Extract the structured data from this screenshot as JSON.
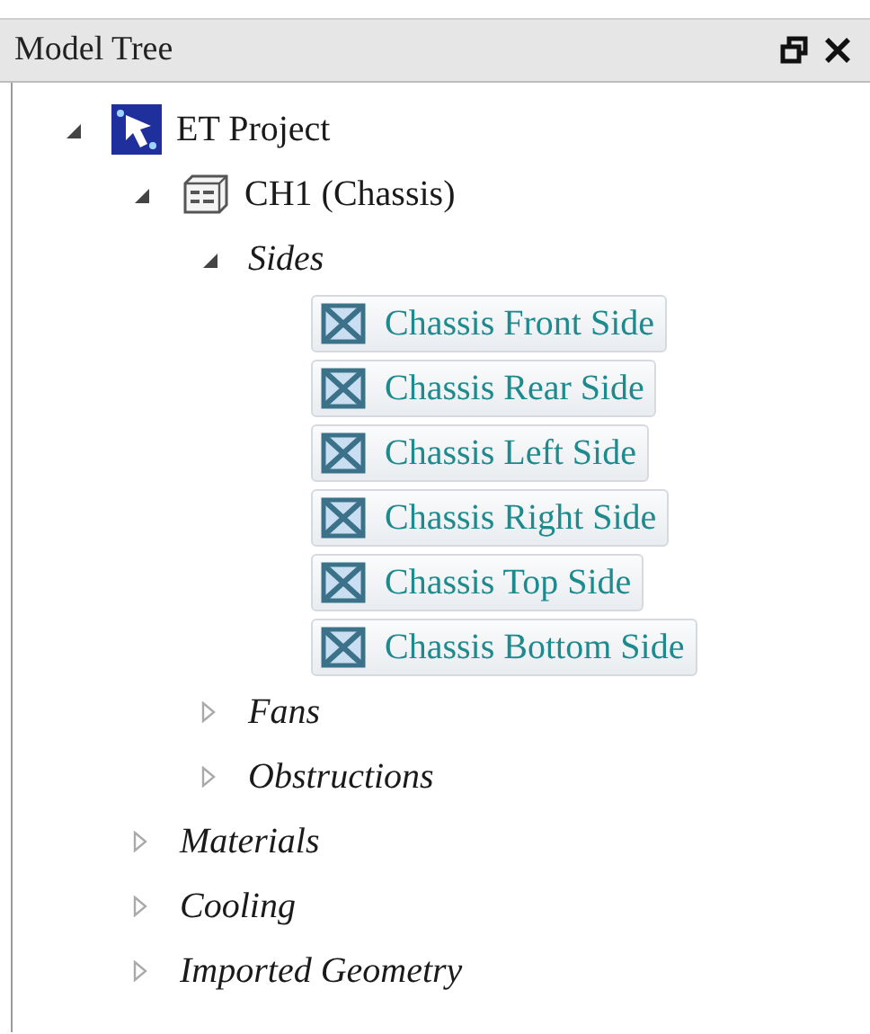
{
  "panel": {
    "title": "Model Tree"
  },
  "tree": [
    {
      "label": "ET Project",
      "kind": "project",
      "expanded": true,
      "selected": false,
      "children": [
        {
          "label": "CH1 (Chassis)",
          "kind": "chassis",
          "expanded": true,
          "selected": false,
          "children": [
            {
              "label": "Sides",
              "kind": "folder",
              "expanded": true,
              "selected": false,
              "children": [
                {
                  "label": "Chassis Front Side",
                  "kind": "side",
                  "selected": true
                },
                {
                  "label": "Chassis Rear Side",
                  "kind": "side",
                  "selected": true
                },
                {
                  "label": "Chassis Left Side",
                  "kind": "side",
                  "selected": true
                },
                {
                  "label": "Chassis Right Side",
                  "kind": "side",
                  "selected": true
                },
                {
                  "label": "Chassis Top Side",
                  "kind": "side",
                  "selected": true
                },
                {
                  "label": "Chassis Bottom Side",
                  "kind": "side",
                  "selected": true
                }
              ]
            },
            {
              "label": "Fans",
              "kind": "folder",
              "expanded": false,
              "selected": false
            },
            {
              "label": "Obstructions",
              "kind": "folder",
              "expanded": false,
              "selected": false
            }
          ]
        },
        {
          "label": "Materials",
          "kind": "folder",
          "expanded": false,
          "selected": false
        },
        {
          "label": "Cooling",
          "kind": "folder",
          "expanded": false,
          "selected": false
        },
        {
          "label": "Imported Geometry",
          "kind": "folder",
          "expanded": false,
          "selected": false
        }
      ]
    }
  ]
}
